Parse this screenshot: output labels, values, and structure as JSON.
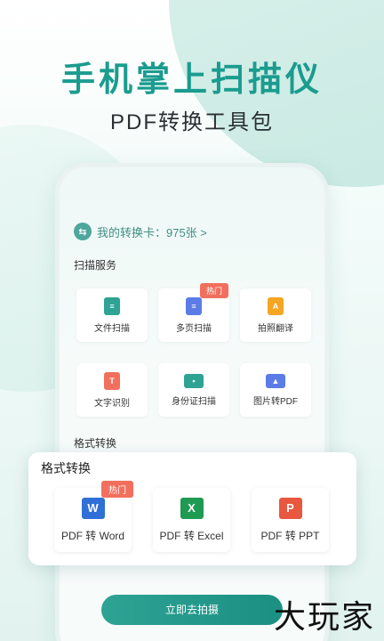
{
  "hero": {
    "title": "手机掌上扫描仪",
    "subtitle": "PDF转换工具包"
  },
  "card": {
    "icon": "swap-icon",
    "text": "我的转换卡：975张 >"
  },
  "scan_section": {
    "label": "扫描服务",
    "tiles": [
      {
        "label": "文件扫描",
        "icon": "document-icon",
        "color": "#2ea394"
      },
      {
        "label": "多页扫描",
        "icon": "pages-icon",
        "color": "#5b7be6",
        "badge": "热门"
      },
      {
        "label": "拍照翻译",
        "icon": "translate-icon",
        "color": "#f5a623"
      },
      {
        "label": "文字识别",
        "icon": "text-icon",
        "color": "#f26f5e"
      },
      {
        "label": "身份证扫描",
        "icon": "id-card-icon",
        "color": "#2ea394"
      },
      {
        "label": "图片转PDF",
        "icon": "image-icon",
        "color": "#5b7be6"
      }
    ]
  },
  "format_section_label": "格式转换",
  "format_card": {
    "title": "格式转换",
    "tiles": [
      {
        "label": "PDF 转 Word",
        "icon": "word-icon",
        "glyph": "W",
        "color": "#2f6fd6",
        "badge": "热门"
      },
      {
        "label": "PDF 转 Excel",
        "icon": "excel-icon",
        "glyph": "X",
        "color": "#1f9a52"
      },
      {
        "label": "PDF 转 PPT",
        "icon": "ppt-icon",
        "glyph": "P",
        "color": "#e9573f"
      }
    ]
  },
  "cta": {
    "label": "立即去拍摄"
  },
  "watermark": "大玩家"
}
